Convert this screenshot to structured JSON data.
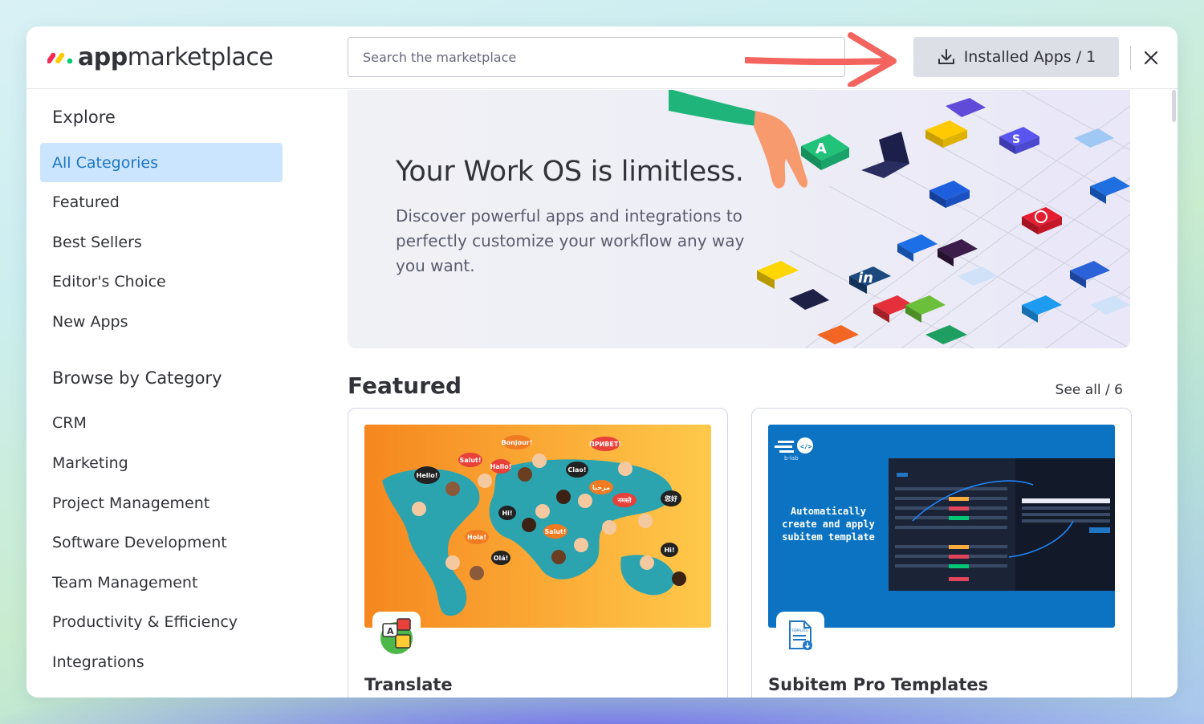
{
  "brand": {
    "logo_bold": "app",
    "logo_regular": "marketplace",
    "colors": {
      "red": "#f62b54",
      "yellow": "#ffcc00",
      "green": "#00ca72"
    }
  },
  "header": {
    "search_placeholder": "Search the marketplace",
    "installed_label": "Installed Apps / 1",
    "installed_icon": "download-icon",
    "close_icon": "close-icon",
    "annotation_arrow_color": "#f4645f"
  },
  "sidebar": {
    "explore_heading": "Explore",
    "explore_items": [
      {
        "label": "All Categories",
        "active": true
      },
      {
        "label": "Featured"
      },
      {
        "label": "Best Sellers"
      },
      {
        "label": "Editor's Choice"
      },
      {
        "label": "New Apps"
      }
    ],
    "browse_heading": "Browse by Category",
    "category_items": [
      {
        "label": "CRM"
      },
      {
        "label": "Marketing"
      },
      {
        "label": "Project Management"
      },
      {
        "label": "Software Development"
      },
      {
        "label": "Team Management"
      },
      {
        "label": "Productivity & Efficiency"
      },
      {
        "label": "Integrations"
      }
    ]
  },
  "banner": {
    "title": "Your Work OS is limitless.",
    "subtitle": "Discover powerful apps and integrations to perfectly customize your workflow any way you want."
  },
  "featured": {
    "title": "Featured",
    "see_all": "See all / 6",
    "cards": [
      {
        "name": "Translate",
        "bubbles": [
          "Bonjour!",
          "ПРИВЕТ!",
          "Salut!",
          "Hello!",
          "Hallo!",
          "Ciao!",
          "مرحبا",
          "Hi!",
          "नमस्ते",
          "您好",
          "Hola!",
          "Salut!",
          "Olá!",
          "Hi!"
        ]
      },
      {
        "name": "Subitem Pro Templates",
        "brand_label": "b-lab",
        "headline_1": "Automatically",
        "headline_2": "create and apply",
        "headline_3": "subitem template",
        "icon_label": "TEMPLATE"
      }
    ]
  }
}
